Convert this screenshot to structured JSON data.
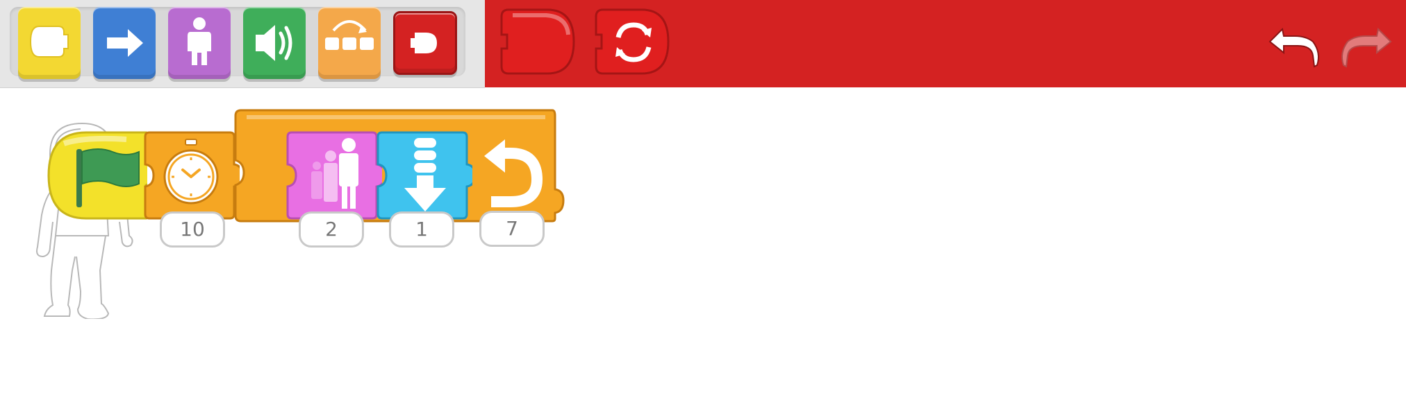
{
  "palette": {
    "categories": [
      {
        "name": "triggering",
        "color": "#f3d832",
        "icon": "trigger-block-icon"
      },
      {
        "name": "motion",
        "color": "#3f7fd4",
        "icon": "arrow-right-icon"
      },
      {
        "name": "looks",
        "color": "#b86cd0",
        "icon": "person-icon"
      },
      {
        "name": "sound",
        "color": "#3fae5a",
        "icon": "speaker-icon"
      },
      {
        "name": "control",
        "color": "#f4a84a",
        "icon": "repeat-puzzle-icon"
      },
      {
        "name": "end",
        "color": "#d42222",
        "icon": "end-block-icon"
      }
    ]
  },
  "action_bar": {
    "color": "#d42222",
    "blocks": [
      "end-block-icon",
      "repeat-forever-icon"
    ],
    "undo": "undo-icon",
    "redo": "redo-icon"
  },
  "script": {
    "sprite": "astronaut-icon",
    "blocks": [
      {
        "type": "green-flag",
        "color": "#f3e12a"
      },
      {
        "type": "wait",
        "color": "#f5a623",
        "value": "10"
      },
      {
        "type": "repeat",
        "color": "#f5a623",
        "value": "7"
      },
      {
        "type": "grow",
        "color": "#e86fe3",
        "value": "2"
      },
      {
        "type": "move-down",
        "color": "#3fc3ee",
        "value": "1"
      }
    ]
  }
}
